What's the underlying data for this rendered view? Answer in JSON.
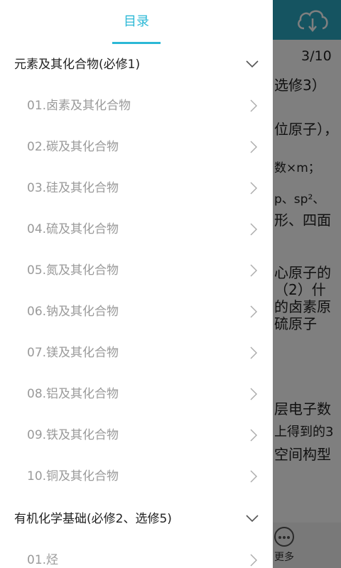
{
  "drawer": {
    "tab_label": "目录",
    "chapters": [
      {
        "title": "元素及其化合物(必修1)",
        "items": [
          "01.卤素及其化合物",
          "02.碳及其化合物",
          "03.硅及其化合物",
          "04.硫及其化合物",
          "05.氮及其化合物",
          "06.钠及其化合物",
          "07.镁及其化合物",
          "08.铝及其化合物",
          "09.铁及其化合物",
          "10.铜及其化合物"
        ]
      },
      {
        "title": "有机化学基础(必修2、选修5)",
        "items": [
          "01.烃"
        ]
      }
    ]
  },
  "background": {
    "page_indicator": "3/10",
    "lines": [
      "选修3）",
      "位原子），",
      "数×m；",
      "p、sp²、",
      "形、四面",
      "心原子的",
      "（2）什",
      "的卤素原",
      "硫原子",
      "层电子数",
      "上得到的3",
      "空间构型"
    ],
    "more_label": "更多",
    "cloud_icon": "cloud-download-icon"
  },
  "colors": {
    "accent": "#2bb8d6",
    "header": "#2aa9c2"
  }
}
